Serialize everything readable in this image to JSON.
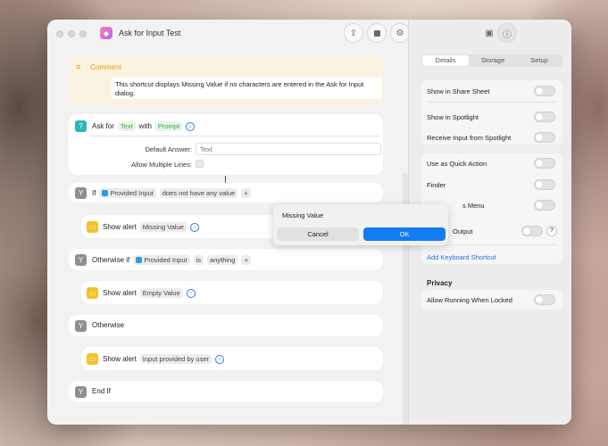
{
  "window": {
    "title": "Ask for Input Test"
  },
  "comment": {
    "title": "Comment",
    "text": "This shortcut displays Missing Value if no characters are entered in the Ask for Input dialog."
  },
  "ask": {
    "label": "Ask for",
    "type_token": "Text",
    "with": "with",
    "prompt_token": "Prompt",
    "default_answer_label": "Default Answer:",
    "default_answer_placeholder": "Text",
    "allow_multiple_label": "Allow Multiple Lines:"
  },
  "if_row": {
    "keyword": "If",
    "var": "Provided Input",
    "condition": "does not have any value"
  },
  "alert1": {
    "label": "Show alert",
    "value": "Missing Value"
  },
  "otherwise_if": {
    "keyword": "Otherwise if",
    "var": "Provided Input",
    "is": "is",
    "value": "anything"
  },
  "alert2": {
    "label": "Show alert",
    "value": "Empty Value"
  },
  "otherwise": {
    "label": "Otherwise"
  },
  "alert3": {
    "label": "Show alert",
    "value": "Input provided by user"
  },
  "end_if": {
    "label": "End If"
  },
  "inspector": {
    "tabs": [
      "Details",
      "Storage",
      "Setup"
    ],
    "active_tab": "Details",
    "share_sheet": "Show in Share Sheet",
    "spotlight": "Show in Spotlight",
    "receive_spotlight": "Receive Input from Spotlight",
    "quick_action": "Use as Quick Action",
    "finder": "Finder",
    "services_menu": "s Menu",
    "output": "Output",
    "help": "?",
    "add_shortcut": "Add Keyboard Shortcut",
    "privacy": "Privacy",
    "running_locked": "Allow Running When Locked"
  },
  "dialog": {
    "message": "Missing Value",
    "cancel": "Cancel",
    "ok": "OK"
  },
  "colors": {
    "accent": "#127cf4",
    "comment_bg": "#fbf3e2",
    "comment_title": "#e0a200",
    "token_green": "#36a447"
  }
}
